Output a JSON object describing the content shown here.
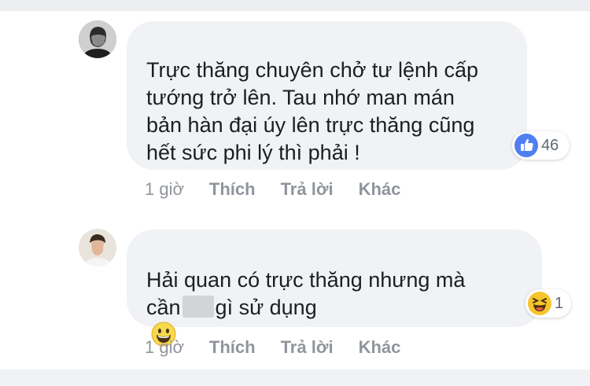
{
  "comments": [
    {
      "text": "Trực thăng chuyên chở tư lệnh cấp\ntướng trở lên. Tau nhớ man mán\nbản hàn đại úy lên trực thăng cũng\nhết sức phi lý thì phải !",
      "reaction": {
        "icon": "like-icon",
        "count": "46"
      },
      "time": "1 giờ",
      "actions": [
        "Thích",
        "Trả lời",
        "Khác"
      ]
    },
    {
      "text_before": "Hải quan có trực thăng nhưng mà\ncần",
      "text_after": "gì sử dụng",
      "emoji": "grinning-face-icon",
      "reaction": {
        "icon": "haha-icon",
        "count": "1"
      },
      "time": "1 giờ",
      "actions": [
        "Thích",
        "Trả lời",
        "Khác"
      ]
    }
  ],
  "colors": {
    "like_blue": "#4f7ff0",
    "haha_yellow": "#f7c42c",
    "bubble": "#f1f2f6",
    "meta": "#90949c"
  }
}
